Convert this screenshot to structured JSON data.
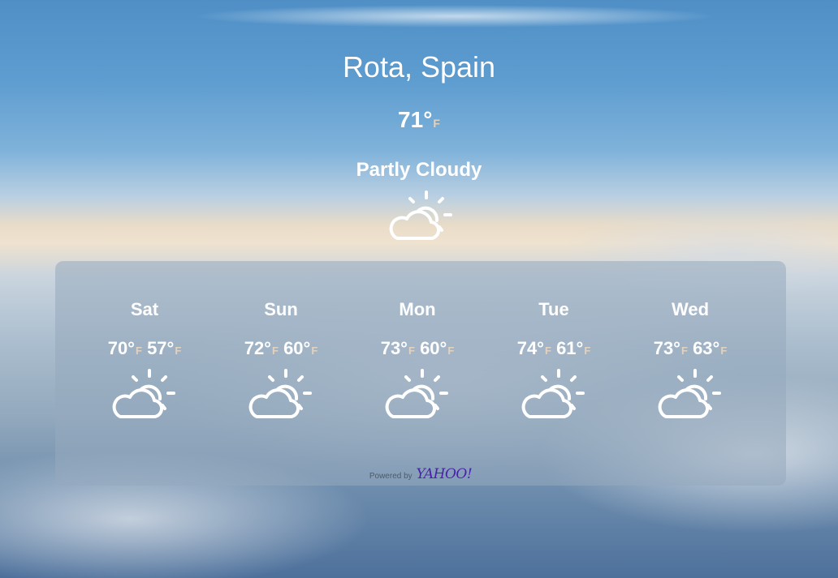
{
  "location": "Rota, Spain",
  "current": {
    "temp": "71°",
    "unit": "F",
    "condition": "Partly Cloudy",
    "icon": "partly-cloudy-day-icon"
  },
  "forecast": [
    {
      "day": "Sat",
      "high": "70°",
      "high_unit": "F",
      "low": "57°",
      "low_unit": "F",
      "icon": "partly-cloudy-day-icon"
    },
    {
      "day": "Sun",
      "high": "72°",
      "high_unit": "F",
      "low": "60°",
      "low_unit": "F",
      "icon": "partly-cloudy-day-icon"
    },
    {
      "day": "Mon",
      "high": "73°",
      "high_unit": "F",
      "low": "60°",
      "low_unit": "F",
      "icon": "partly-cloudy-day-icon"
    },
    {
      "day": "Tue",
      "high": "74°",
      "high_unit": "F",
      "low": "61°",
      "low_unit": "F",
      "icon": "partly-cloudy-day-icon"
    },
    {
      "day": "Wed",
      "high": "73°",
      "high_unit": "F",
      "low": "63°",
      "low_unit": "F",
      "icon": "partly-cloudy-day-icon"
    }
  ],
  "attribution": {
    "powered_by": "Powered by",
    "brand": "YAHOO!"
  },
  "colors": {
    "unit_accent": "#e2d2bf",
    "panel": "rgba(150,170,190,0.55)",
    "brand": "#4a1fb0"
  }
}
